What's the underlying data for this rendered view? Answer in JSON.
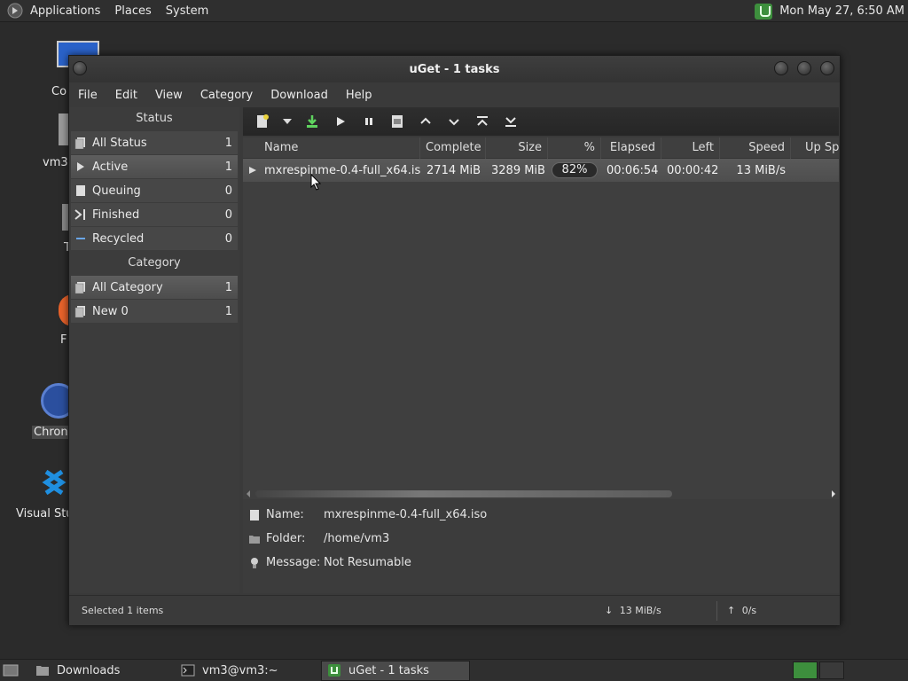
{
  "top_panel": {
    "menus": [
      "Applications",
      "Places",
      "System"
    ],
    "clock": "Mon May 27,  6:50 AM"
  },
  "desktop": {
    "icons": [
      {
        "label": "Co"
      },
      {
        "label": "vm3"
      },
      {
        "label": "T"
      },
      {
        "label": "F"
      },
      {
        "label": "Chron"
      },
      {
        "label": "Visual Stu"
      }
    ]
  },
  "window": {
    "title": "uGet - 1 tasks",
    "menu": [
      "File",
      "Edit",
      "View",
      "Category",
      "Download",
      "Help"
    ]
  },
  "sidebar": {
    "status_header": "Status",
    "status_items": [
      {
        "label": "All Status",
        "count": "1"
      },
      {
        "label": "Active",
        "count": "1"
      },
      {
        "label": "Queuing",
        "count": "0"
      },
      {
        "label": "Finished",
        "count": "0"
      },
      {
        "label": "Recycled",
        "count": "0"
      }
    ],
    "category_header": "Category",
    "category_items": [
      {
        "label": "All Category",
        "count": "1"
      },
      {
        "label": "New 0",
        "count": "1"
      }
    ]
  },
  "list": {
    "columns": [
      "Name",
      "Complete",
      "Size",
      "%",
      "Elapsed",
      "Left",
      "Speed",
      "Up Spe"
    ],
    "rows": [
      {
        "name": "mxrespinme-0.4-full_x64.iso",
        "complete": "2714 MiB",
        "size": "3289 MiB",
        "percent": "82%",
        "elapsed": "00:06:54",
        "left": "00:00:42",
        "speed": "13 MiB/s",
        "up_speed": ""
      }
    ]
  },
  "details": {
    "name_label": "Name:",
    "name_value": "mxrespinme-0.4-full_x64.iso",
    "folder_label": "Folder:",
    "folder_value": "/home/vm3",
    "message_label": "Message:",
    "message_value": "Not Resumable"
  },
  "statusbar": {
    "selected": "Selected 1 items",
    "down_speed": "13 MiB/s",
    "up_speed": "0/s"
  },
  "taskbar": {
    "tasks": [
      {
        "label": "Downloads"
      },
      {
        "label": "vm3@vm3:~"
      },
      {
        "label": "uGet - 1 tasks"
      }
    ]
  },
  "colors": {
    "accent_green": "#3d8f3d",
    "selection": "#555555",
    "chrome_blue": "#2b4f9e"
  }
}
